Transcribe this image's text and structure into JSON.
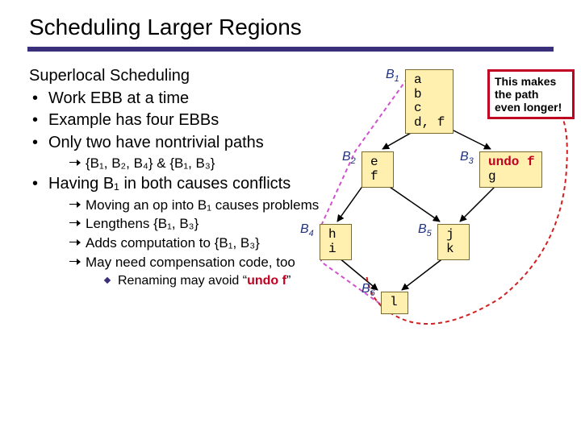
{
  "title": "Scheduling Larger Regions",
  "heading": "Superlocal Scheduling",
  "bullets": {
    "b1": "Work EBB at a time",
    "b2": "Example has four EBBs",
    "b3": "Only two have nontrivial paths",
    "b4": "Having B₁ in both causes conflicts"
  },
  "sub_b3": "{B₁, B₂, B₄} & {B₁, B₃}",
  "sub_b4": {
    "a": "Moving an op into B₁ causes problems",
    "b": "Lengthens {B₁, B₃}",
    "c": "Adds computation to {B₁, B₃}",
    "d": "May need compensation code, too",
    "d1_pre": "Renaming may avoid “",
    "d1_undo": "undo f",
    "d1_post": "”"
  },
  "labels": {
    "B1": "B",
    "B1s": "1",
    "B2": "B",
    "B2s": "2",
    "B3": "B",
    "B3s": "3",
    "B4": "B",
    "B4s": "4",
    "B5": "B",
    "B5s": "5",
    "B6": "B",
    "B6s": "6"
  },
  "blocks": {
    "B1": "a\nb\nc\nd, f",
    "B2": "e\nf",
    "B3_pre": "undo f",
    "B3_line2": "g",
    "B4": "h\ni",
    "B5": "j\nk",
    "B6": "l"
  },
  "callout": "This makes the path even longer!"
}
